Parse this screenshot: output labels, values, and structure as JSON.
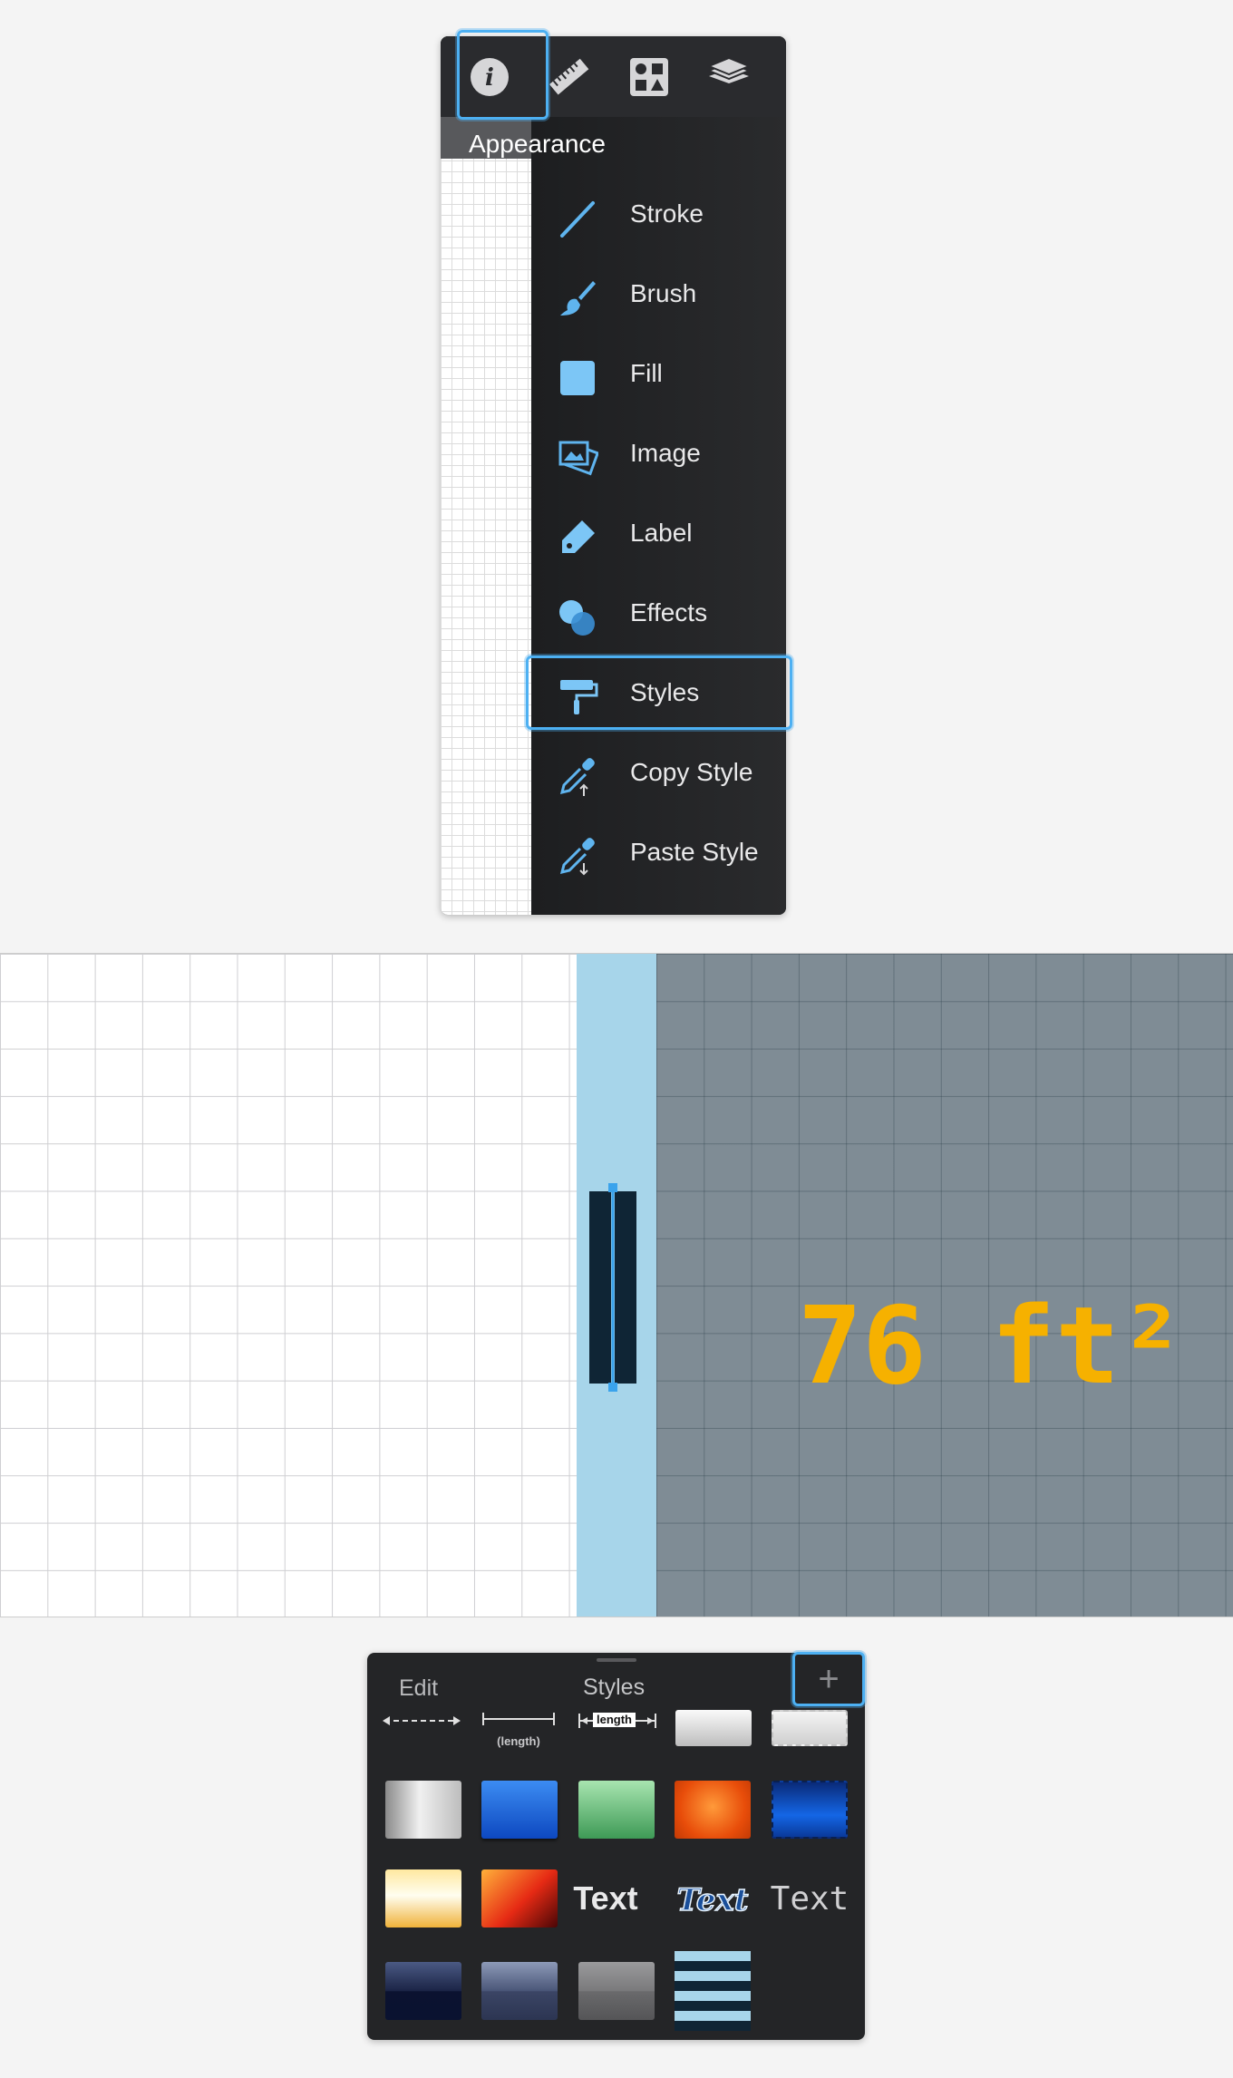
{
  "menu": {
    "toolbar": {
      "info": "info-icon",
      "ruler": "ruler-icon",
      "shapes": "shapes-library-icon",
      "layers": "layers-icon"
    },
    "header": "Appearance",
    "items": [
      {
        "label": "Stroke",
        "icon": "stroke-icon"
      },
      {
        "label": "Brush",
        "icon": "brush-icon"
      },
      {
        "label": "Fill",
        "icon": "fill-icon"
      },
      {
        "label": "Image",
        "icon": "image-icon"
      },
      {
        "label": "Label",
        "icon": "label-tag-icon"
      },
      {
        "label": "Effects",
        "icon": "effects-icon"
      },
      {
        "label": "Styles",
        "icon": "paint-roller-icon",
        "selected": true
      },
      {
        "label": "Copy Style",
        "icon": "copy-style-eyedropper-icon"
      },
      {
        "label": "Paste Style",
        "icon": "paste-style-eyedropper-icon"
      }
    ],
    "accent": "#4db0f2"
  },
  "plan": {
    "area_label": "76 ft²",
    "area_color": "#f6b100",
    "room_color": "#7f8c95",
    "wall_color": "#a7d5ea"
  },
  "styles": {
    "edit": "Edit",
    "title": "Styles",
    "add": "+",
    "dimension_length": "length",
    "dimension_length_paren": "(length)",
    "text_samples": [
      "Text",
      "Text",
      "Text"
    ]
  }
}
